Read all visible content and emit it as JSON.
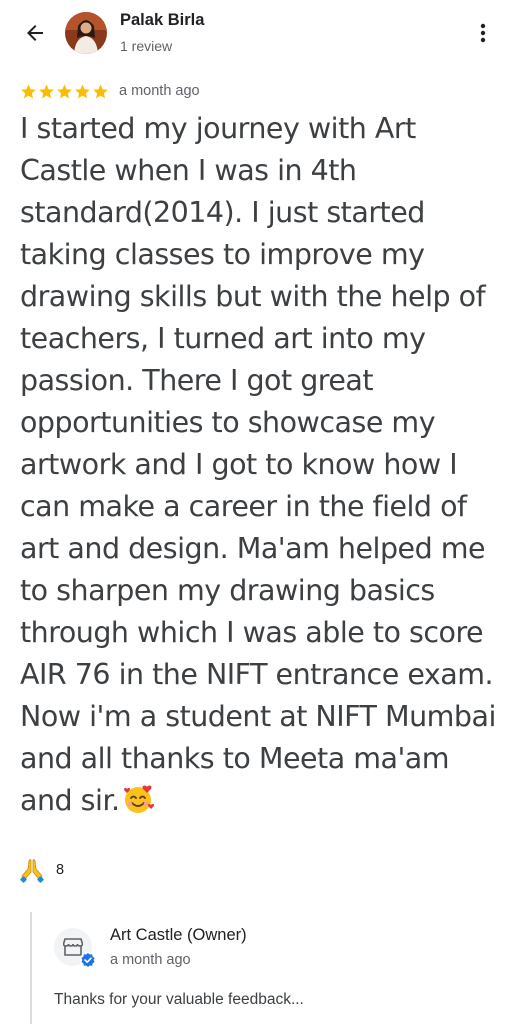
{
  "header": {
    "reviewer_name": "Palak Birla",
    "reviewer_meta": "1 review",
    "back_icon": "arrow-back-icon",
    "more_icon": "more-vertical-icon"
  },
  "review": {
    "rating": 5,
    "max_rating": 5,
    "date": "a month ago",
    "lines": [
      "I started my journey with Art",
      "Castle when I was in 4th",
      "standard(2014). I just started",
      "taking classes to improve my",
      "drawing skills but with the help of",
      "teachers, I turned art into my",
      "passion. There I got great",
      "opportunities to showcase my",
      "artwork and I got to know how I",
      "can make a career in the field of",
      "art and design. Ma'am helped me",
      "to sharpen my drawing basics",
      "through which I was able to score",
      "AIR 76 in the NIFT entrance exam.",
      "Now i'm a student at NIFT Mumbai",
      "and all thanks to Meeta ma'am",
      "and sir."
    ],
    "trailing_emoji": "smiling-face-with-hearts-emoji"
  },
  "reaction": {
    "icon": "folded-hands-emoji",
    "count": "8"
  },
  "owner_reply": {
    "name": "Art Castle (Owner)",
    "date": "a month ago",
    "text": "Thanks for your valuable feedback...",
    "avatar_icon": "storefront-icon",
    "badge_icon": "verified-check-icon"
  },
  "colors": {
    "star": "#fbbc04",
    "primary_text": "#202124",
    "body_text": "#3c4043",
    "secondary_text": "#5f6368",
    "verified": "#1a73e8",
    "divider": "#dadce0"
  }
}
